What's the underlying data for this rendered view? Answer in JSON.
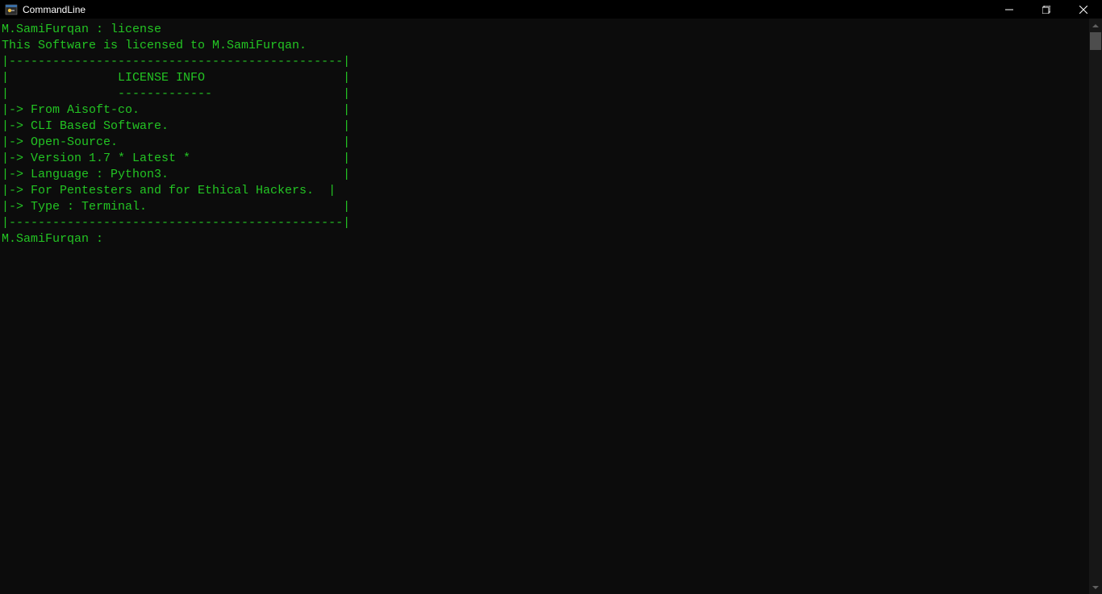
{
  "window": {
    "title": "CommandLine"
  },
  "terminal": {
    "lines": [
      "M.SamiFurqan : license",
      "",
      "This Software is licensed to M.SamiFurqan.",
      "|----------------------------------------------|",
      "|               LICENSE INFO                   |",
      "|               -------------                  |",
      "|-> From Aisoft-co.                            |",
      "|-> CLI Based Software.                        |",
      "|-> Open-Source.                               |",
      "|-> Version 1.7 * Latest *                     |",
      "|-> Language : Python3.                        |",
      "|-> For Pentesters and for Ethical Hackers.  |",
      "|-> Type : Terminal.                           |",
      "|----------------------------------------------|",
      "",
      "M.SamiFurqan : "
    ]
  }
}
